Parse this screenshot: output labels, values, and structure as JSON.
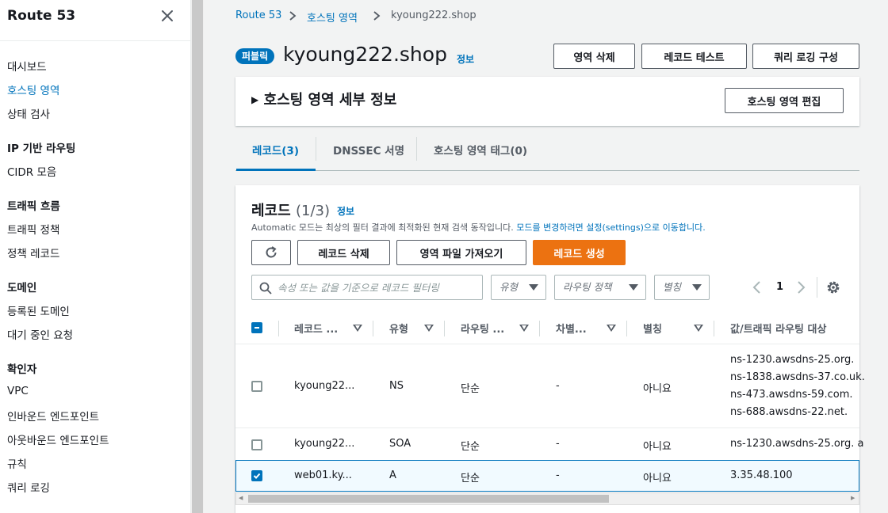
{
  "sidebar": {
    "title": "Route 53",
    "items": [
      {
        "label": "대시보드"
      },
      {
        "label": "호스팅 영역"
      },
      {
        "label": "상태 검사"
      },
      {
        "label": "IP 기반 라우팅"
      },
      {
        "label": "CIDR 모음"
      },
      {
        "label": "트래픽 흐름"
      },
      {
        "label": "트래픽 정책"
      },
      {
        "label": "정책 레코드"
      },
      {
        "label": "도메인"
      },
      {
        "label": "등록된 도메인"
      },
      {
        "label": "대기 중인 요청"
      },
      {
        "label": "확인자"
      },
      {
        "label": "VPC"
      },
      {
        "label": "인바운드 엔드포인트"
      },
      {
        "label": "아웃바운드 엔드포인트"
      },
      {
        "label": "규칙"
      },
      {
        "label": "쿼리 로깅"
      }
    ]
  },
  "breadcrumb": [
    "Route 53",
    "호스팅 영역",
    "kyoung222.shop"
  ],
  "header": {
    "badge": "퍼블릭",
    "title": "kyoung222.shop",
    "info": "정보",
    "buttons": {
      "delete_zone": "영역 삭제",
      "test_record": "레코드 테스트",
      "query_logging": "쿼리 로깅 구성"
    }
  },
  "details": {
    "title": "호스팅 영역 세부 정보",
    "edit": "호스팅 영역 편집"
  },
  "tabs": [
    {
      "label": "레코드(3)"
    },
    {
      "label": "DNSSEC 서명"
    },
    {
      "label": "호스팅 영역 태그(0)"
    }
  ],
  "records": {
    "title": "레코드",
    "count": "(1/3)",
    "info": "정보",
    "desc_prefix": "Automatic 모드는 최상의 필터 결과에 최적화된 현재 검색 동작입니다. ",
    "desc_link": "모드를 변경하려면 설정(settings)으로 이동합니다.",
    "buttons": {
      "delete": "레코드 삭제",
      "import": "영역 파일 가져오기",
      "create": "레코드 생성"
    },
    "search_placeholder": "속성 또는 값을 기준으로 레코드 필터링",
    "filters": {
      "type": "유형",
      "routing": "라우팅 정책",
      "alias": "별칭"
    },
    "page": "1",
    "columns": [
      "레코드 ...",
      "유형",
      "라우팅 ...",
      "차별...",
      "별칭",
      "값/트래픽 라우팅 대상"
    ],
    "rows": [
      {
        "name": "kyoung22...",
        "type": "NS",
        "routing": "단순",
        "diff": "-",
        "alias": "아니요",
        "values": [
          "ns-1230.awsdns-25.org.",
          "ns-1838.awsdns-37.co.uk.",
          "ns-473.awsdns-59.com.",
          "ns-688.awsdns-22.net."
        ],
        "selected": false
      },
      {
        "name": "kyoung22...",
        "type": "SOA",
        "routing": "단순",
        "diff": "-",
        "alias": "아니요",
        "values": [
          "ns-1230.awsdns-25.org. a"
        ],
        "selected": false
      },
      {
        "name": "web01.ky...",
        "type": "A",
        "routing": "단순",
        "diff": "-",
        "alias": "아니요",
        "values": [
          "3.35.48.100"
        ],
        "selected": true
      }
    ]
  },
  "colors": {
    "accent": "#0073bb",
    "primary_button": "#ec7211"
  }
}
